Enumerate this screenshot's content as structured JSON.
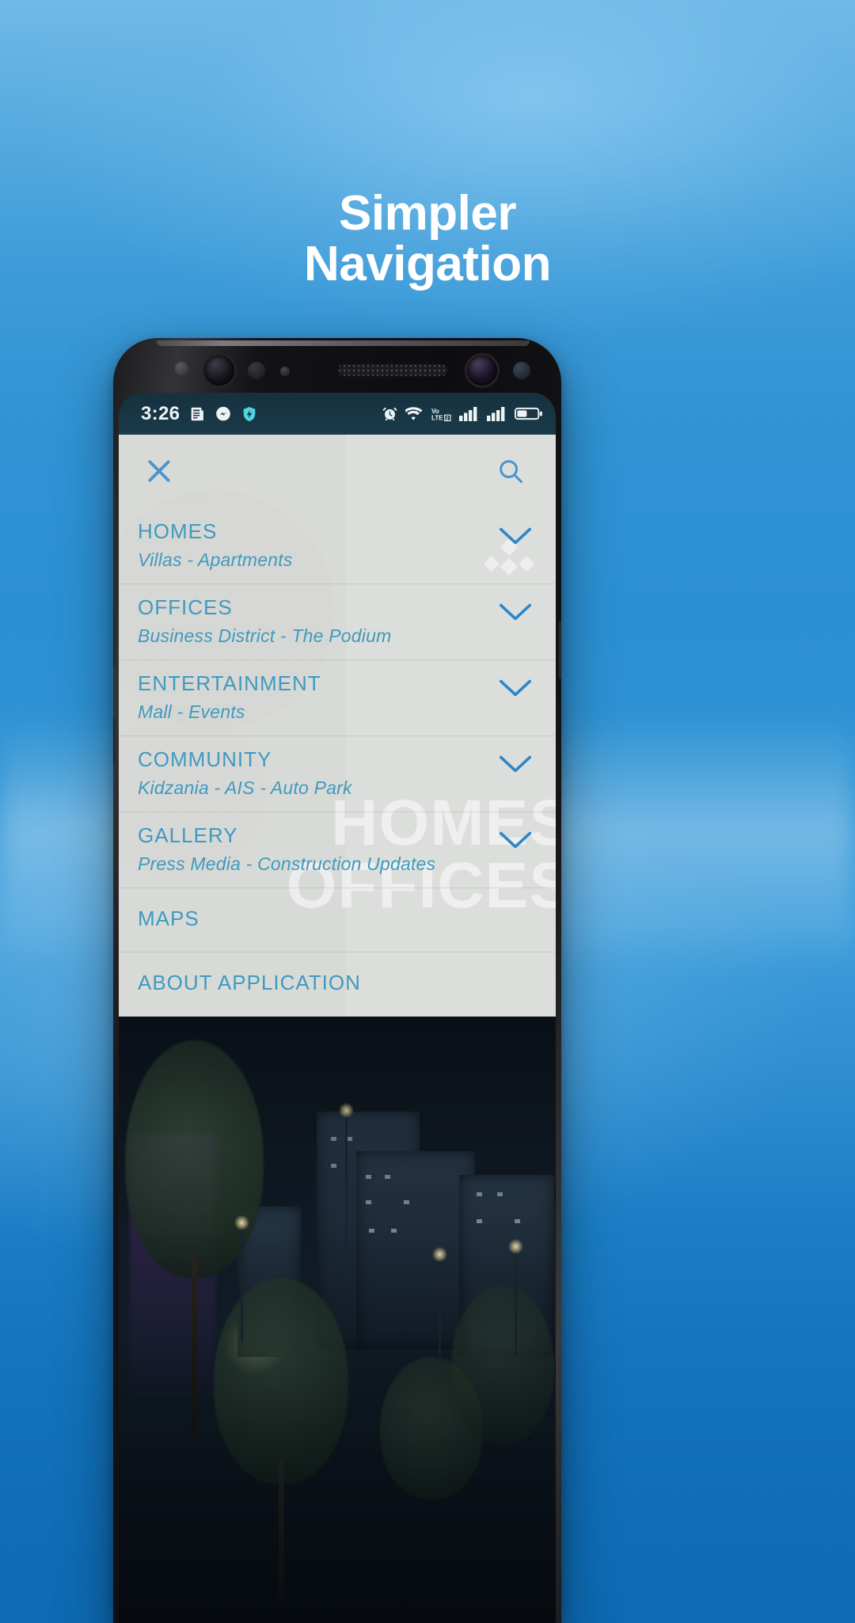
{
  "promo": {
    "headline_line1": "Simpler",
    "headline_line2": "Navigation",
    "background_color": "#2a8fd4"
  },
  "phone": {
    "status_bar": {
      "clock": "3:26",
      "left_icons": [
        "news-icon",
        "messenger-icon",
        "shield-icon"
      ],
      "right_icons": [
        "alarm-icon",
        "wifi-icon",
        "volte-icon",
        "signal-sim1-icon",
        "signal-sim2-icon",
        "battery-icon"
      ],
      "network_label": "Vo",
      "network_label2": "LTE",
      "sim_badge": "2",
      "battery_level_percent": 45,
      "background_color": "#1a3a4a"
    },
    "drawer": {
      "background_color": "#dcdedb",
      "accent_color": "#3f9abe",
      "close_icon": "close-x-icon",
      "search_icon": "search-icon",
      "watermark_line1": "HOMES",
      "watermark_line2": "OFFICES",
      "menu_items": [
        {
          "title": "HOMES",
          "subtitle": "Villas - Apartments",
          "expandable": true
        },
        {
          "title": "OFFICES",
          "subtitle": "Business District - The Podium",
          "expandable": true
        },
        {
          "title": "ENTERTAINMENT",
          "subtitle": "Mall - Events",
          "expandable": true
        },
        {
          "title": "COMMUNITY",
          "subtitle": "Kidzania - AIS - Auto Park",
          "expandable": true
        },
        {
          "title": "GALLERY",
          "subtitle": "Press Media - Construction Updates",
          "expandable": true
        },
        {
          "title": "MAPS",
          "subtitle": "",
          "expandable": false
        },
        {
          "title": "ABOUT APPLICATION",
          "subtitle": "",
          "expandable": false
        }
      ]
    }
  }
}
